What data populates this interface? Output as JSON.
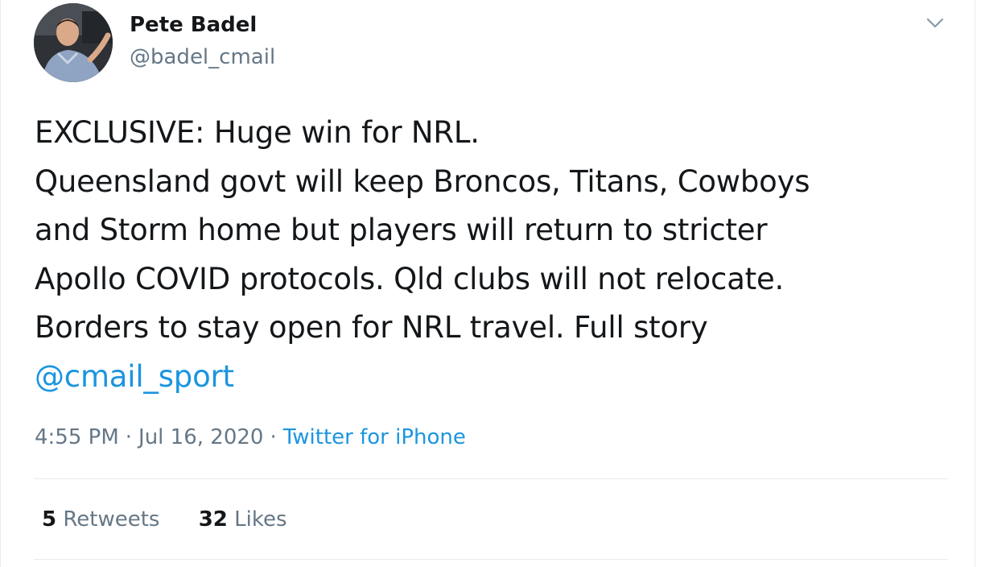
{
  "author": {
    "display_name": "Pete Badel",
    "handle": "@badel_cmail"
  },
  "tweet": {
    "lines": [
      "EXCLUSIVE: Huge win for NRL.",
      "Queensland govt will keep Broncos, Titans, Cowboys",
      "and Storm home but players will return to stricter",
      "Apollo COVID protocols. Qld clubs will not relocate.",
      "Borders to stay open for NRL travel. Full story"
    ],
    "mention": "@cmail_sport"
  },
  "meta": {
    "time": "4:55 PM",
    "separator": "·",
    "date": "Jul 16, 2020",
    "source": "Twitter for iPhone"
  },
  "stats": {
    "retweets_count": "5",
    "retweets_label": "Retweets",
    "likes_count": "32",
    "likes_label": "Likes"
  },
  "icons": {
    "menu": "chevron-down-icon"
  },
  "colors": {
    "text": "#14171a",
    "secondary": "#657786",
    "link": "#1b95e0",
    "divider": "#e6ecf0"
  }
}
